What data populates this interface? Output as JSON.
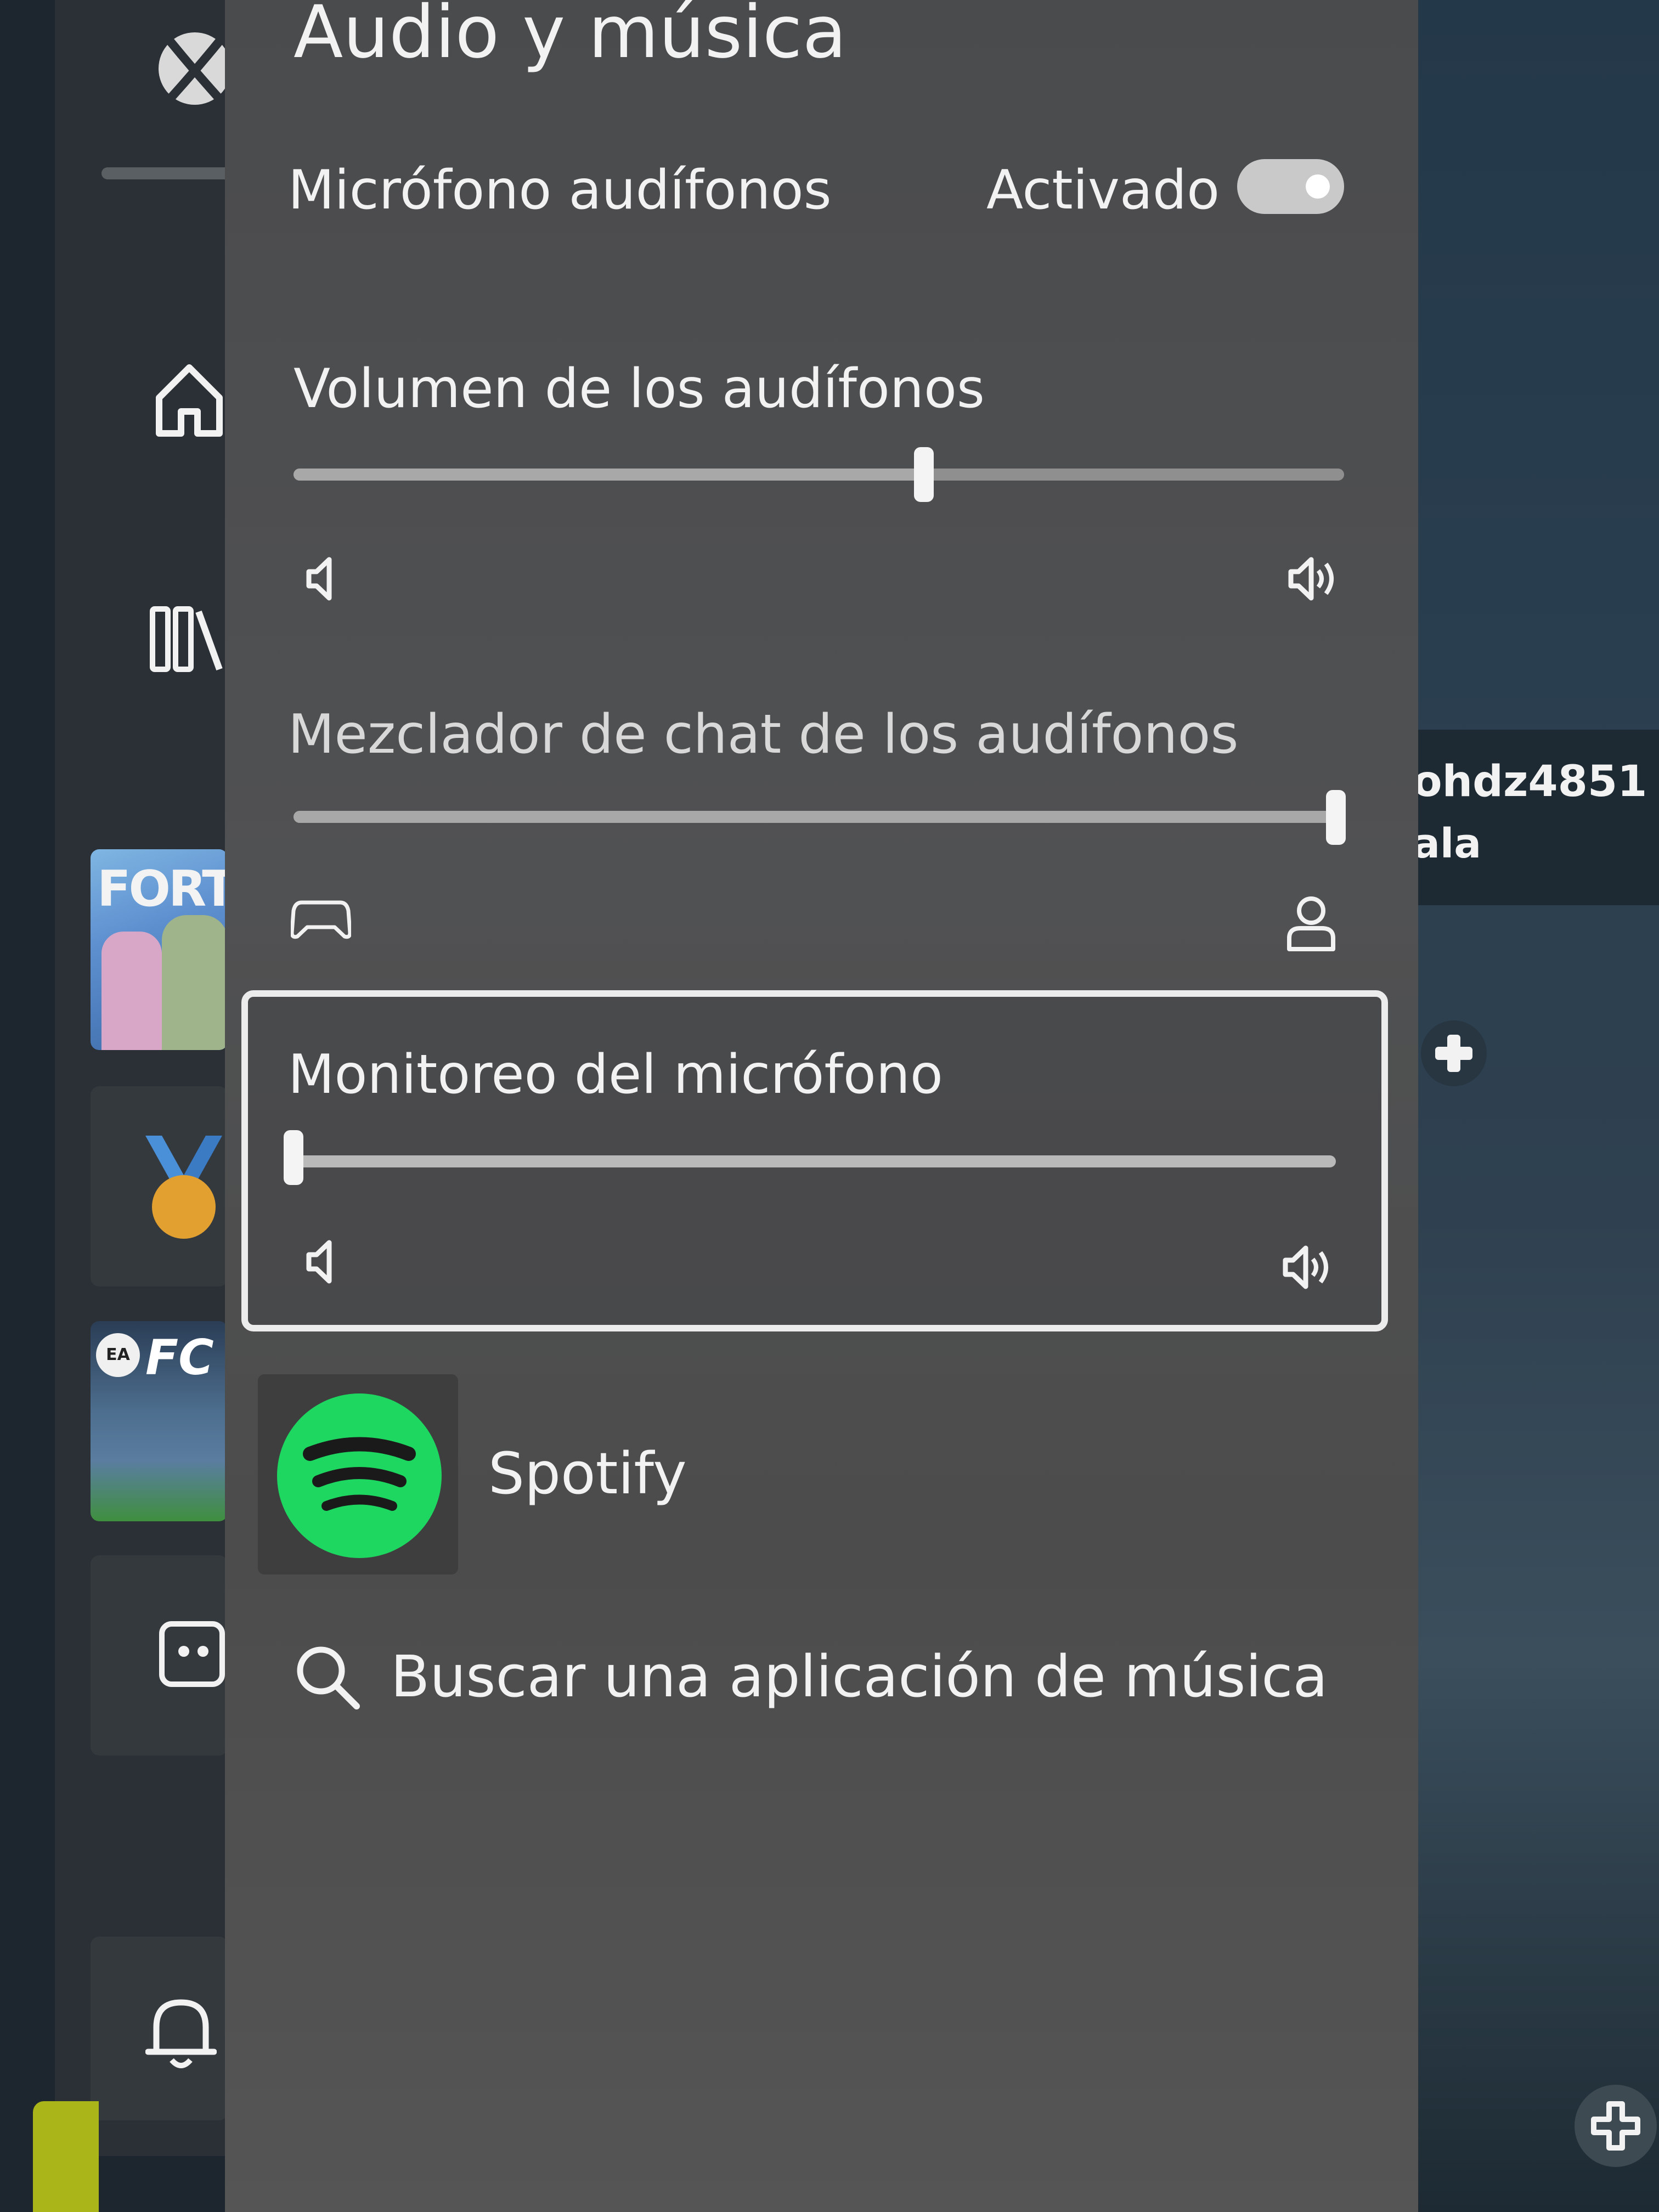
{
  "panel": {
    "title": "Audio y música",
    "headset_mic": {
      "label": "Micrófono audífonos",
      "state": "Activado",
      "on": true
    },
    "headset_volume": {
      "label": "Volumen de los audífonos",
      "value": 0.6
    },
    "chat_mixer": {
      "label": "Mezclador de chat de los audífonos",
      "value": 1.0
    },
    "mic_monitoring": {
      "label": "Monitoreo del micrófono",
      "value": 0.0
    },
    "music_app": {
      "name": "Spotify"
    },
    "search": {
      "label": "Buscar una aplicación de música"
    }
  },
  "rail": {
    "tiles": [
      {
        "title": "FORTN"
      },
      {
        "title": ""
      },
      {
        "title": "FC",
        "badge": "EA"
      },
      {
        "title": ""
      }
    ]
  },
  "profile": {
    "gamertag": "ohdz4851",
    "status": "ala"
  },
  "icons": {
    "logo": "xbox-logo",
    "home": "home-icon",
    "library": "library-icon",
    "medal": "medal-icon",
    "games": "games-icon",
    "bell": "bell-icon",
    "volume_low": "volume-low-icon",
    "volume_high": "volume-high-icon",
    "controller": "controller-icon",
    "person": "person-icon",
    "search": "search-icon",
    "add": "add-icon",
    "party": "party-icon"
  },
  "colors": {
    "accent_green": "#3ddc6a",
    "spotify_green": "#1ed760",
    "panel_bg": "#4c4c4c"
  }
}
